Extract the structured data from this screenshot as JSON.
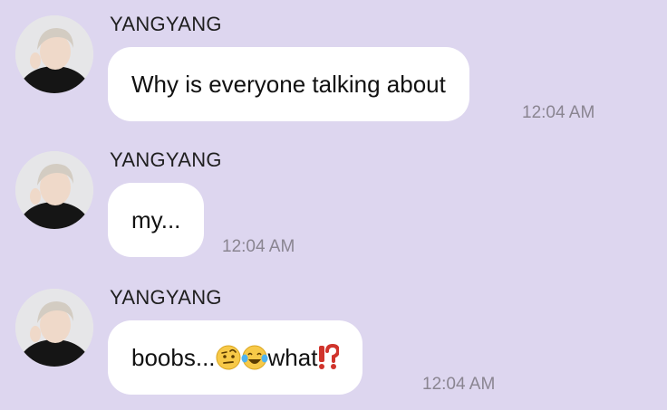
{
  "theme": {
    "background": "#ddd6ef",
    "bubble": "#ffffff",
    "timestamp_color": "#8a8591"
  },
  "messages": [
    {
      "sender": "YANGYANG",
      "avatar": "person-avatar",
      "text": "Why is everyone talking about",
      "time": "12:04 AM"
    },
    {
      "sender": "YANGYANG",
      "avatar": "person-avatar",
      "text": "my...",
      "time": "12:04 AM"
    },
    {
      "sender": "YANGYANG",
      "avatar": "person-avatar",
      "text_before": "boobs...",
      "emojis": [
        "raised-eyebrow-emoji",
        "tears-of-joy-emoji"
      ],
      "text_after": "what",
      "trailing_emoji": "exclamation-question-emoji",
      "time": "12:04 AM"
    }
  ]
}
